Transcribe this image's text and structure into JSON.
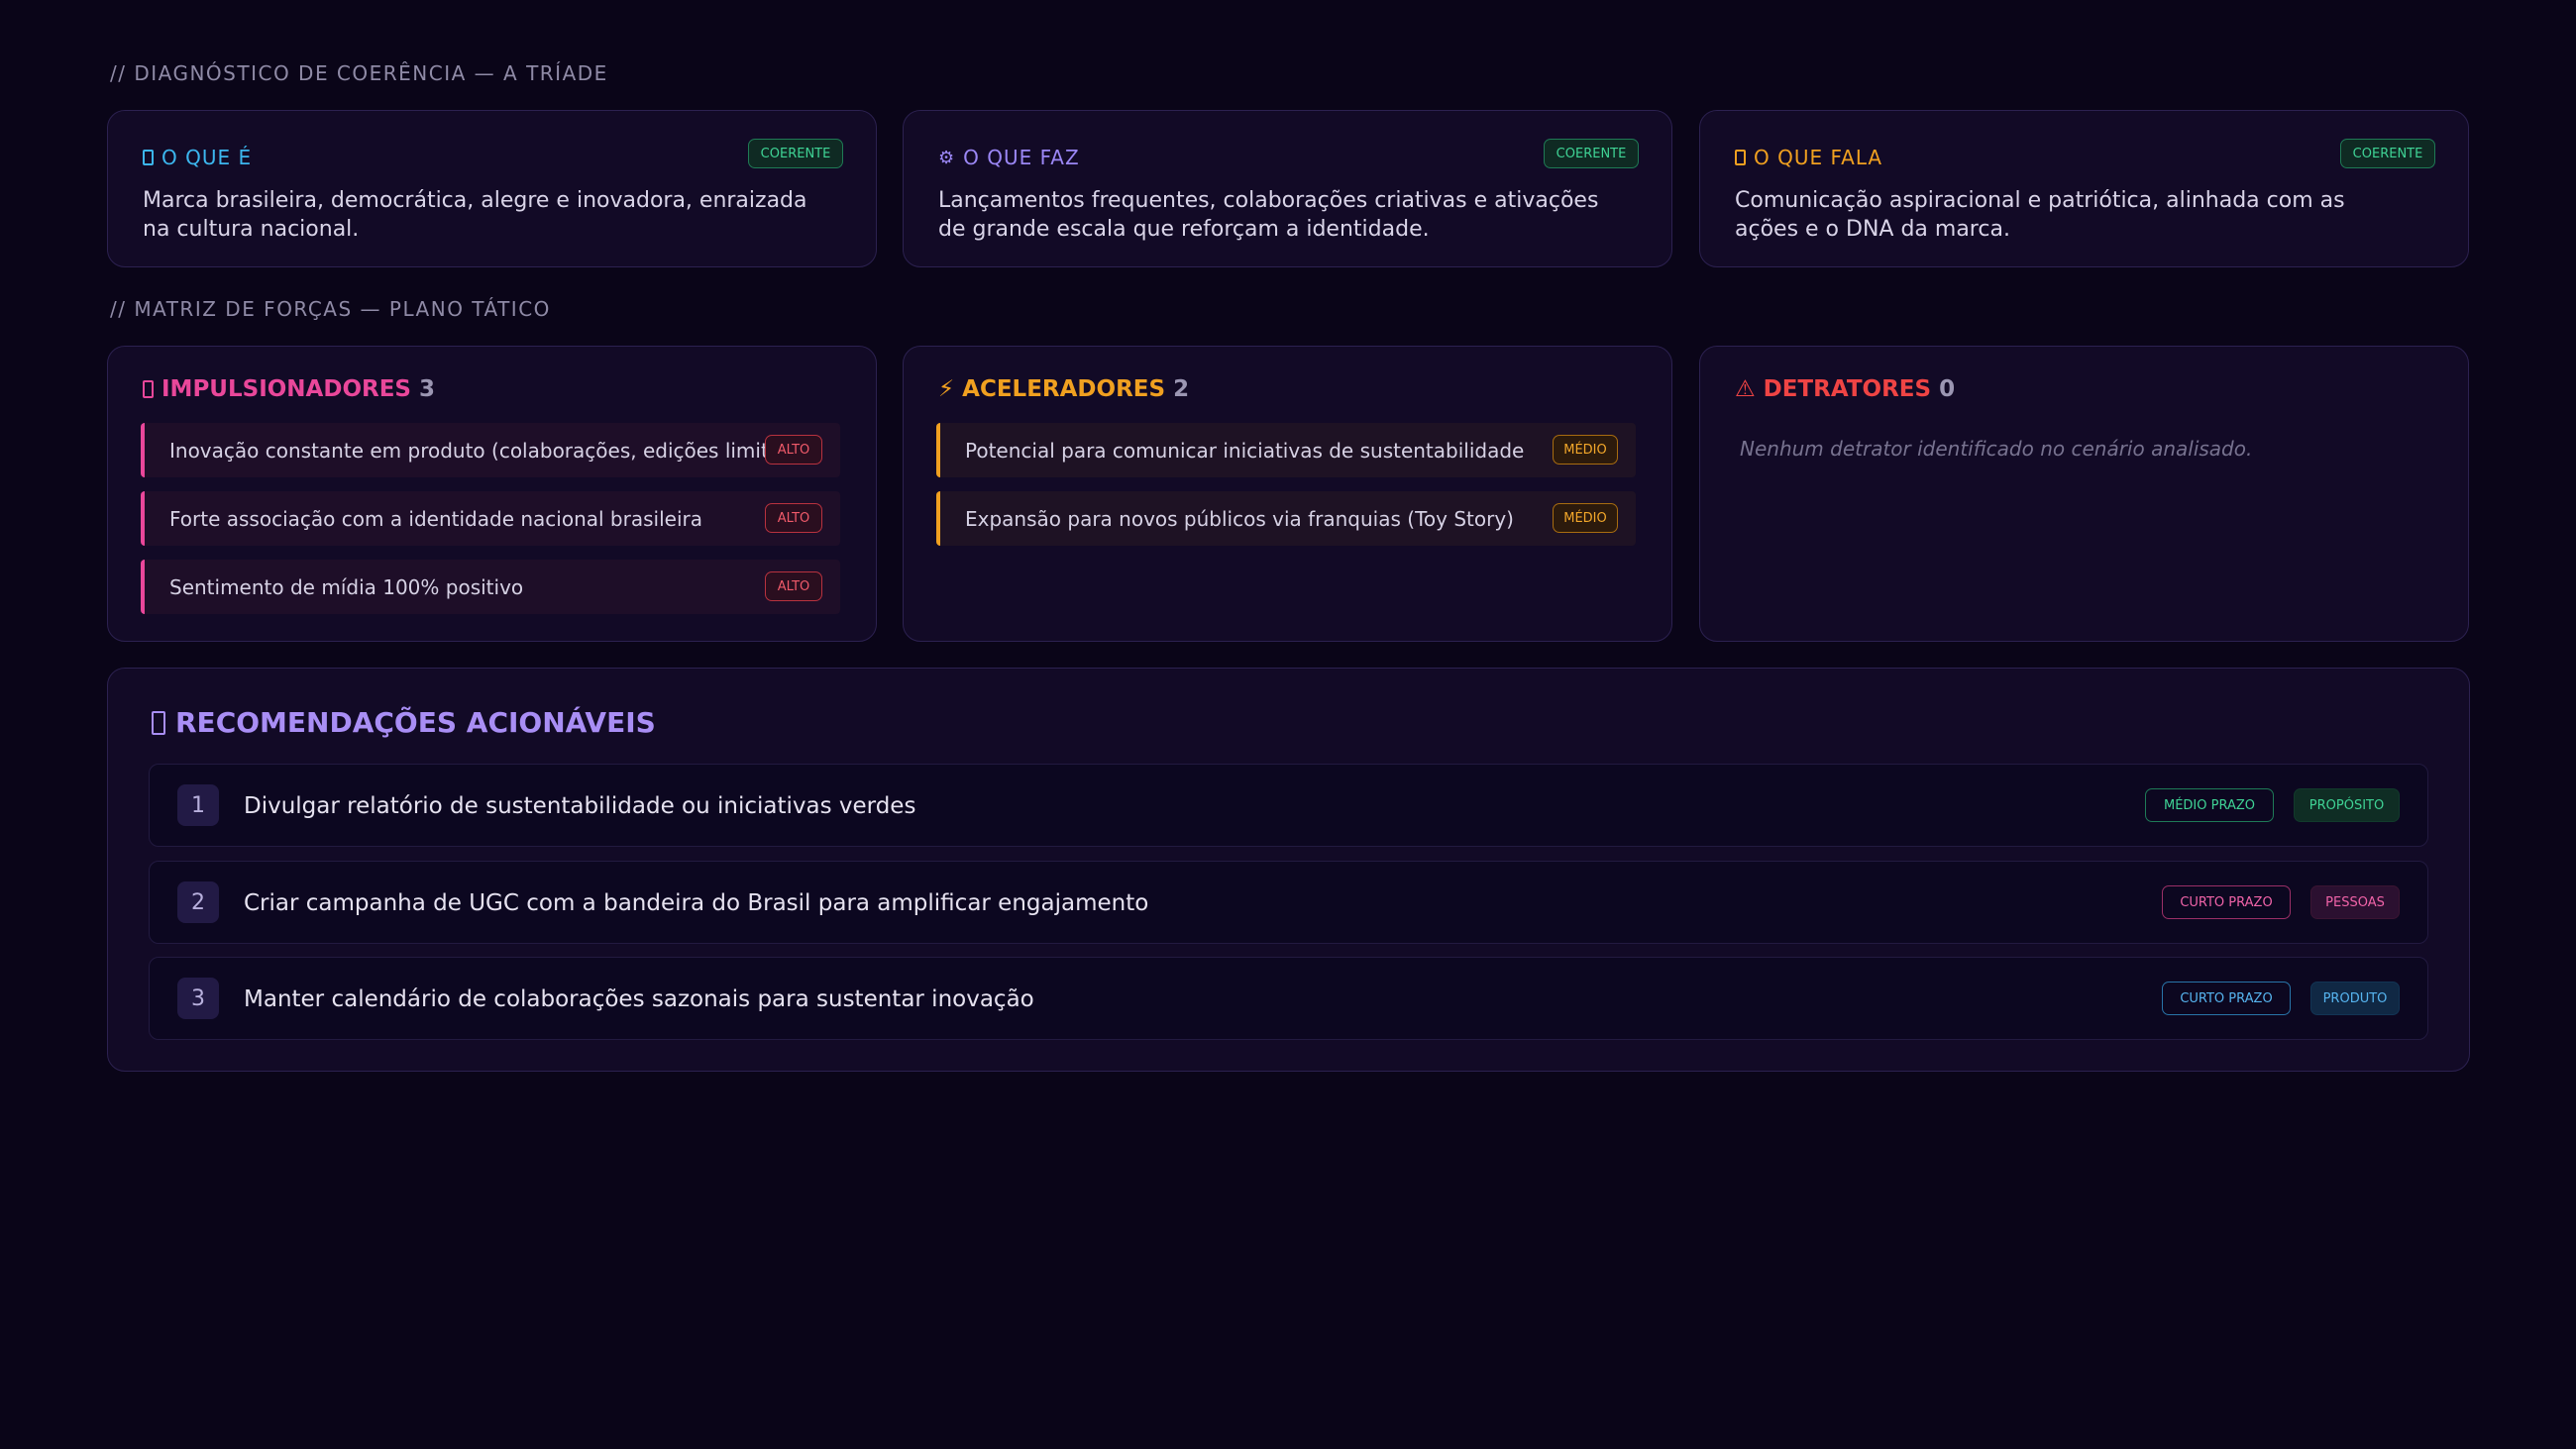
{
  "triad": {
    "section_label": "// DIAGNÓSTICO DE COERÊNCIA — A TRÍADE",
    "cards": [
      {
        "title": "O QUE É",
        "badge": "COERENTE",
        "text": "Marca brasileira, democrática, alegre e inovadora, enraizada na cultura nacional.",
        "color": "#3cb6ee",
        "icon": "identity-box-icon"
      },
      {
        "title": "O QUE FAZ",
        "badge": "COERENTE",
        "text": "Lançamentos frequentes, colaborações criativas e ativações de grande escala que reforçam a identidade.",
        "color": "#9b87f5",
        "icon": "gear-icon"
      },
      {
        "title": "O QUE FALA",
        "badge": "COERENTE",
        "text": "Comunicação aspiracional e patriótica, alinhada com as ações e o DNA da marca.",
        "color": "#f0a020",
        "icon": "speech-box-icon"
      }
    ]
  },
  "forces": {
    "section_label": "// MATRIZ DE FORÇAS — PLANO TÁTICO",
    "impulsionadores": {
      "title": "IMPULSIONADORES",
      "count": "3",
      "color": "#e9479a",
      "items": [
        {
          "text": "Inovação constante em produto (colaborações, edições limitadas)",
          "level": "ALTO"
        },
        {
          "text": "Forte associação com a identidade nacional brasileira",
          "level": "ALTO"
        },
        {
          "text": "Sentimento de mídia 100% positivo",
          "level": "ALTO"
        }
      ]
    },
    "aceleradores": {
      "title": "ACELERADORES",
      "count": "2",
      "color": "#f0a020",
      "icon_glyph": "⚡",
      "items": [
        {
          "text": "Potencial para comunicar iniciativas de sustentabilidade",
          "level": "MÉDIO"
        },
        {
          "text": "Expansão para novos públicos via franquias (Toy Story)",
          "level": "MÉDIO"
        }
      ]
    },
    "detratores": {
      "title": "DETRATORES",
      "count": "0",
      "color": "#ef4444",
      "icon_glyph": "⚠",
      "empty_text": "Nenhum detrator identificado no cenário analisado."
    }
  },
  "recommendations": {
    "title": "RECOMENDAÇÕES ACIONÁVEIS",
    "color": "#a98ef5",
    "items": [
      {
        "num": "1",
        "text": "Divulgar relatório de sustentabilidade ou iniciativas verdes",
        "term": "MÉDIO PRAZO",
        "category": "PROPÓSITO"
      },
      {
        "num": "2",
        "text": "Criar campanha de UGC com a bandeira do Brasil para amplificar engajamento",
        "term": "CURTO PRAZO",
        "category": "PESSOAS"
      },
      {
        "num": "3",
        "text": "Manter calendário de colaborações sazonais para sustentar inovação",
        "term": "CURTO PRAZO",
        "category": "PRODUTO"
      }
    ]
  }
}
